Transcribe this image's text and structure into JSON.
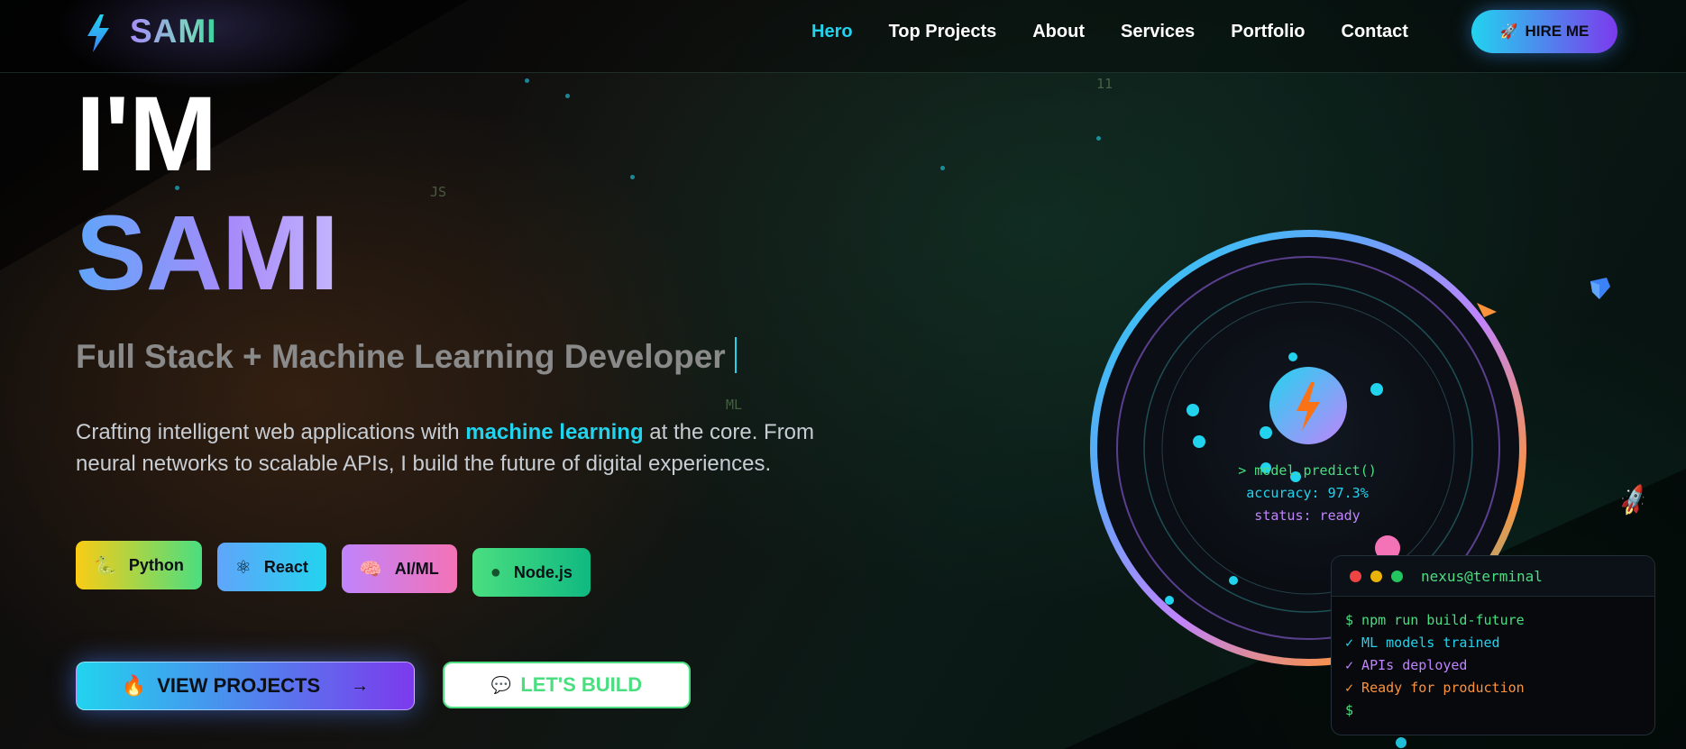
{
  "brand": {
    "name": "SAMI",
    "logo_icon": "lightning-bolt-icon"
  },
  "nav": {
    "links": [
      {
        "label": "Hero",
        "active": true
      },
      {
        "label": "Top Projects",
        "active": false
      },
      {
        "label": "About",
        "active": false
      },
      {
        "label": "Services",
        "active": false
      },
      {
        "label": "Portfolio",
        "active": false
      },
      {
        "label": "Contact",
        "active": false
      }
    ],
    "hire_button": {
      "icon": "rocket-icon",
      "glyph": "🚀",
      "label": "HIRE ME"
    }
  },
  "hero": {
    "greeting": "I'M",
    "name": "SAMI",
    "subtitle": "Full Stack + Machine Learning Developer",
    "description_before": "Crafting intelligent web applications with ",
    "description_highlight": "machine learning",
    "description_after": " at the core. From neural networks to scalable APIs, I build the future of digital experiences.",
    "skills": [
      {
        "label": "Python",
        "icon": "python-icon",
        "glyph": "🐍"
      },
      {
        "label": "React",
        "icon": "react-icon",
        "glyph": "⚛"
      },
      {
        "label": "AI/ML",
        "icon": "brain-icon",
        "glyph": "🧠"
      },
      {
        "label": "Node.js",
        "icon": "node-icon",
        "glyph": "●"
      }
    ],
    "primary_cta": {
      "icon": "fire-icon",
      "glyph": "🔥",
      "label": "VIEW PROJECTS",
      "arrow": "→"
    },
    "secondary_cta": {
      "icon": "speech-bubble-icon",
      "glyph": "💬",
      "label": "LET'S BUILD"
    }
  },
  "floating_labels": [
    "11",
    "JS",
    "ML"
  ],
  "orb_code": {
    "line1": "> model.predict()",
    "line2": "accuracy: 97.3%",
    "line3": "status: ready"
  },
  "terminal": {
    "title": "nexus@terminal",
    "lines": [
      "$ npm run build-future",
      "✓ ML models trained",
      "✓ APIs deployed",
      "✓ Ready for production",
      "$"
    ]
  },
  "colors": {
    "accent_cyan": "#22d3ee",
    "accent_purple": "#7c3aed",
    "accent_green": "#4ade80",
    "accent_orange": "#fb923c"
  }
}
